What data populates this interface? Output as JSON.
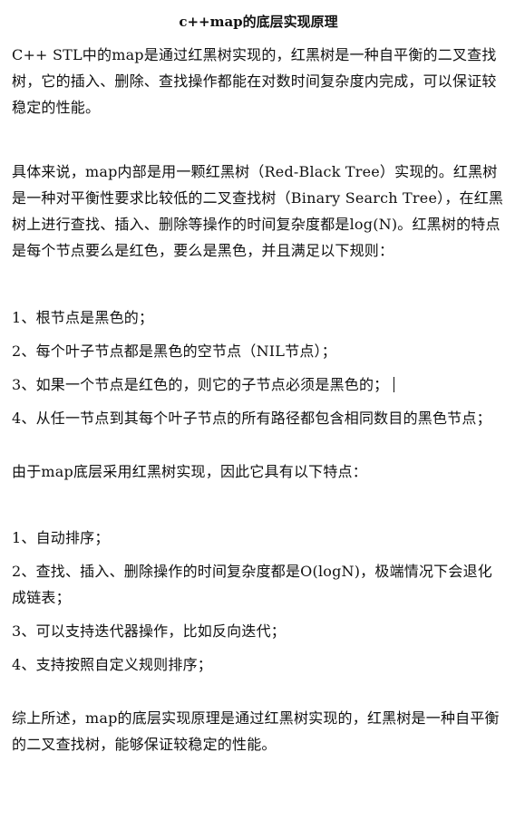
{
  "title": "c++map的底层实现原理",
  "intro": "C++ STL中的map是通过红黑树实现的，红黑树是一种自平衡的二叉查找树，它的插入、删除、查找操作都能在对数时间复杂度内完成，可以保证较稳定的性能。",
  "detail": "具体来说，map内部是用一颗红黑树（Red-Black Tree）实现的。红黑树是一种对平衡性要求比较低的二叉查找树（Binary Search Tree），在红黑树上进行查找、插入、删除等操作的时间复杂度都是log(N)。红黑树的特点是每个节点要么是红色，要么是黑色，并且满足以下规则：",
  "rules": [
    "1、根节点是黑色的；",
    "2、每个叶子节点都是黑色的空节点（NIL节点）；",
    "3、如果一个节点是红色的，则它的子节点必须是黑色的；",
    "4、从任一节点到其每个叶子节点的所有路径都包含相同数目的黑色节点；"
  ],
  "features_intro": "由于map底层采用红黑树实现，因此它具有以下特点：",
  "features": [
    "1、自动排序；",
    "2、查找、插入、删除操作的时间复杂度都是O(logN)，极端情况下会退化成链表；",
    "3、可以支持迭代器操作，比如反向迭代；",
    "4、支持按照自定义规则排序；"
  ],
  "conclusion": "综上所述，map的底层实现原理是通过红黑树实现的，红黑树是一种自平衡的二叉查找树，能够保证较稳定的性能。"
}
